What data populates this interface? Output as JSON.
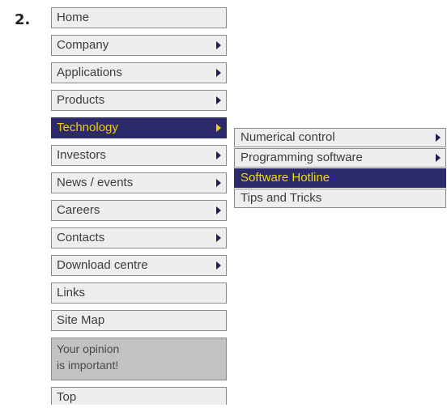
{
  "step": "2.",
  "menu": {
    "items": [
      {
        "label": "Home",
        "has_submenu": false
      },
      {
        "label": "Company",
        "has_submenu": true
      },
      {
        "label": "Applications",
        "has_submenu": true
      },
      {
        "label": "Products",
        "has_submenu": true
      },
      {
        "label": "Technology",
        "has_submenu": true,
        "active": true
      },
      {
        "label": "Investors",
        "has_submenu": true
      },
      {
        "label": "News / events",
        "has_submenu": true
      },
      {
        "label": "Careers",
        "has_submenu": true
      },
      {
        "label": "Contacts",
        "has_submenu": true
      },
      {
        "label": "Download centre",
        "has_submenu": true
      },
      {
        "label": "Links",
        "has_submenu": false
      },
      {
        "label": "Site Map",
        "has_submenu": false
      }
    ],
    "opinion": {
      "line1": "Your opinion",
      "line2": "is important!"
    },
    "top": {
      "label": "Top"
    }
  },
  "submenu": {
    "items": [
      {
        "label": "Numerical control",
        "has_submenu": true
      },
      {
        "label": "Programming software",
        "has_submenu": true
      },
      {
        "label": "Software Hotline",
        "has_submenu": false,
        "highlighted": true
      },
      {
        "label": "Tips and Tricks",
        "has_submenu": false
      }
    ]
  },
  "colors": {
    "item_background": "#eeeeee",
    "item_border": "#8a8a8a",
    "active_background": "#2d2a6b",
    "active_text": "#f0d000",
    "opinion_background": "#c2c2c2",
    "arrow": "#1e1e50"
  }
}
